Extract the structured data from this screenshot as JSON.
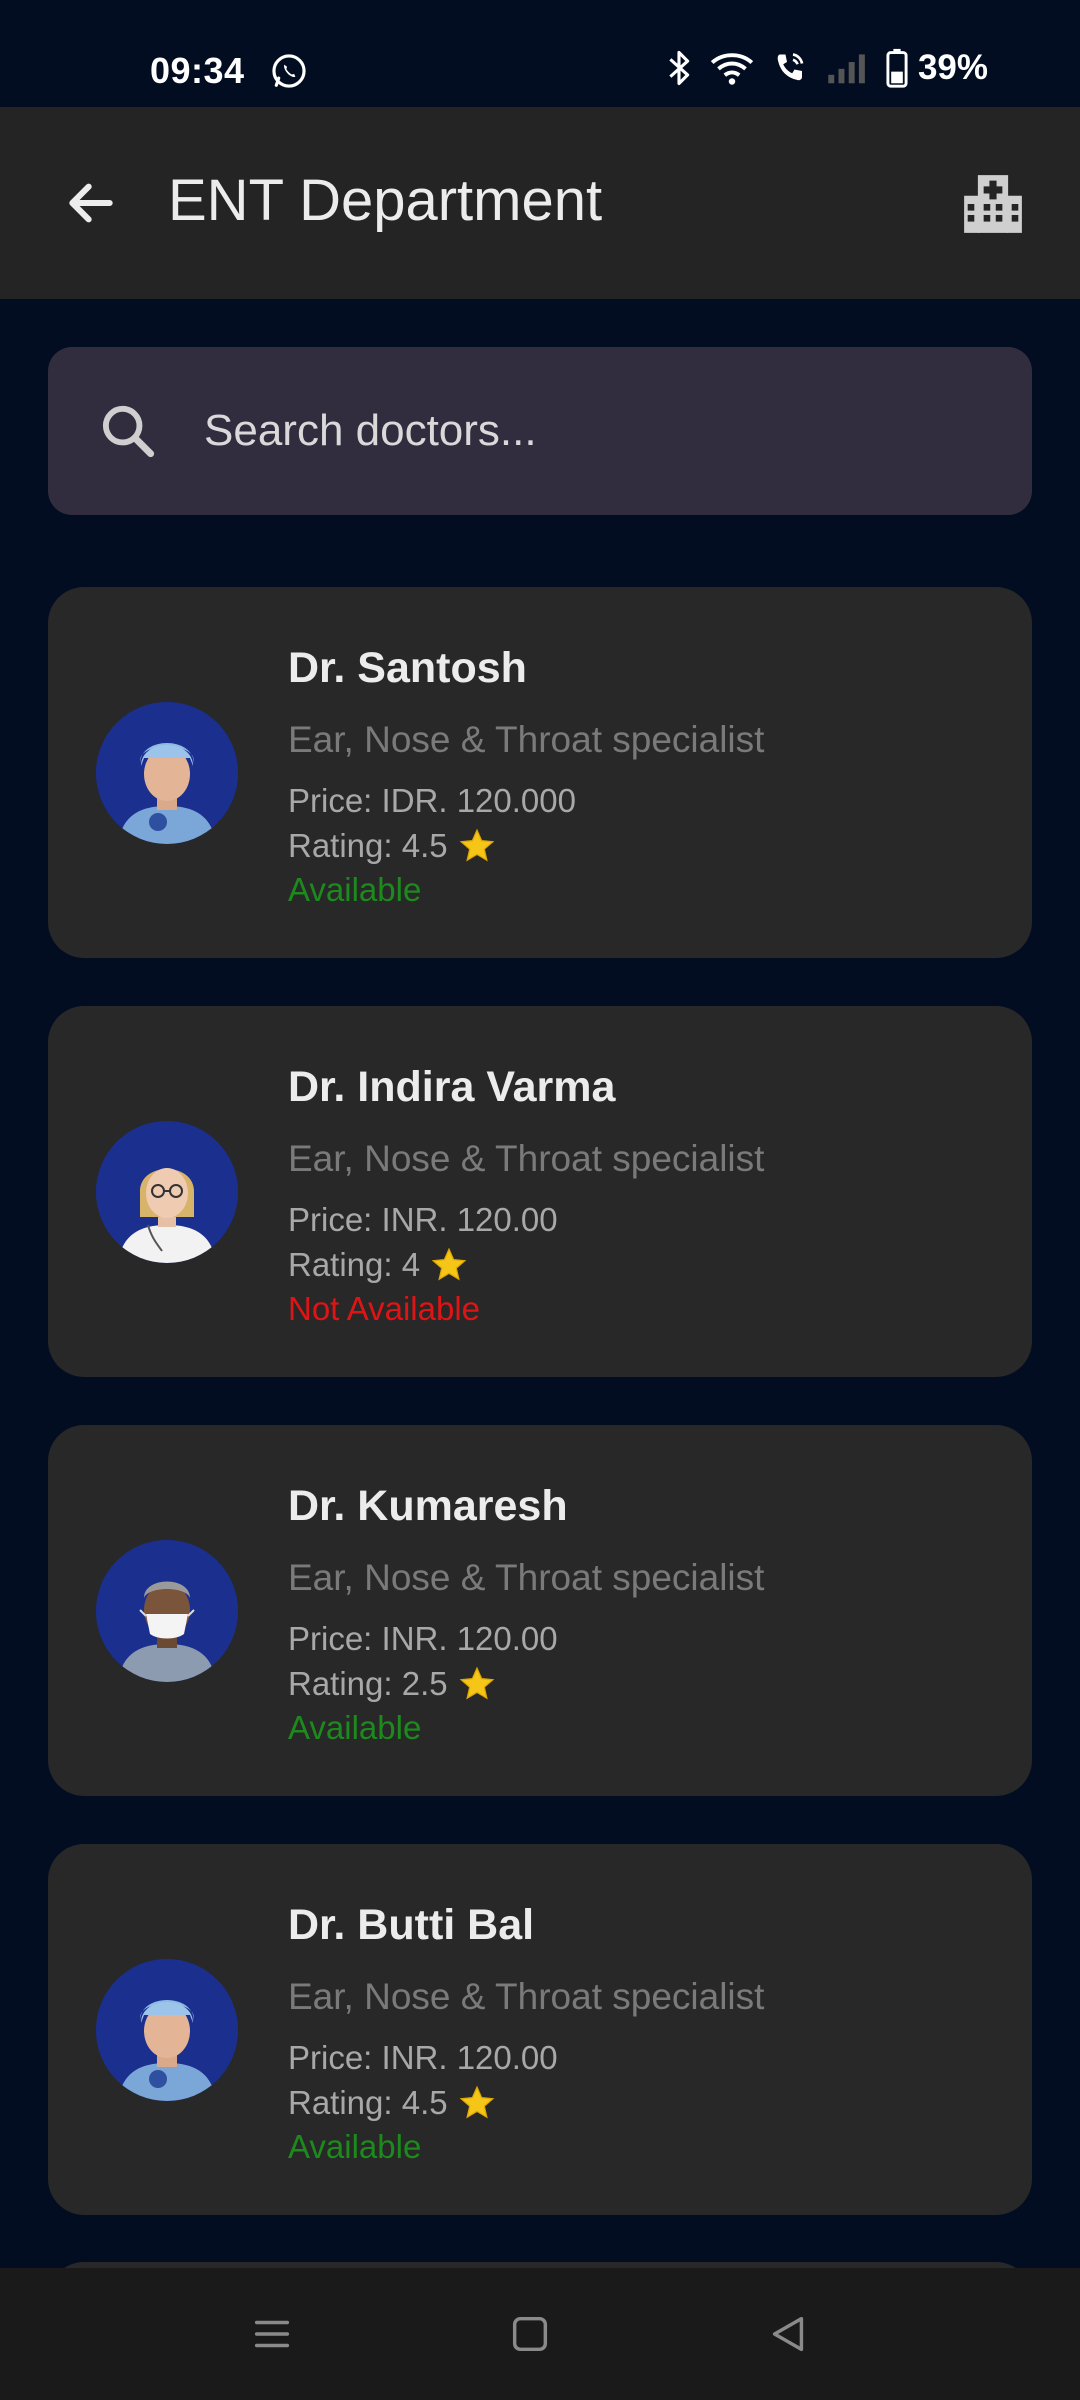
{
  "status_bar": {
    "time": "09:34",
    "battery": "39%",
    "icons": [
      "whatsapp-icon",
      "bluetooth-icon",
      "wifi-icon",
      "wifi-calling-icon",
      "signal-icon",
      "battery-icon"
    ]
  },
  "app_bar": {
    "title": "ENT Department",
    "back_icon": "arrow-left-icon",
    "action_icon": "hospital-building-icon"
  },
  "search": {
    "placeholder": "Search doctors...",
    "value": ""
  },
  "doctors": [
    {
      "name": "Dr. Santosh",
      "specialty": "Ear, Nose & Throat specialist",
      "price": "Price: IDR. 120.000",
      "rating": "Rating: 4.5",
      "status": "Available",
      "avatar": "male-doctor-surgical-cap"
    },
    {
      "name": "Dr. Indira Varma",
      "specialty": "Ear, Nose & Throat specialist",
      "price": "Price: INR. 120.00",
      "rating": "Rating: 4",
      "status": "Not Available",
      "avatar": "female-doctor-glasses"
    },
    {
      "name": "Dr. Kumaresh",
      "specialty": "Ear, Nose & Throat specialist",
      "price": "Price: INR. 120.00",
      "rating": "Rating: 2.5",
      "status": "Available",
      "avatar": "male-doctor-mask"
    },
    {
      "name": "Dr. Butti Bal",
      "specialty": "Ear, Nose & Throat specialist",
      "price": "Price: INR. 120.00",
      "rating": "Rating: 4.5",
      "status": "Available",
      "avatar": "male-doctor-surgical-cap"
    }
  ],
  "colors": {
    "background": "#020d21",
    "app_bar": "#242424",
    "card": "#282828",
    "search": "#312d3f",
    "available": "#1c8a1c",
    "not_available": "#e01414",
    "star": "#f5c518",
    "avatar_bg": "#1b2f8f"
  },
  "nav_bar": {
    "icons": [
      "menu-icon",
      "home-square-icon",
      "back-triangle-icon"
    ]
  }
}
